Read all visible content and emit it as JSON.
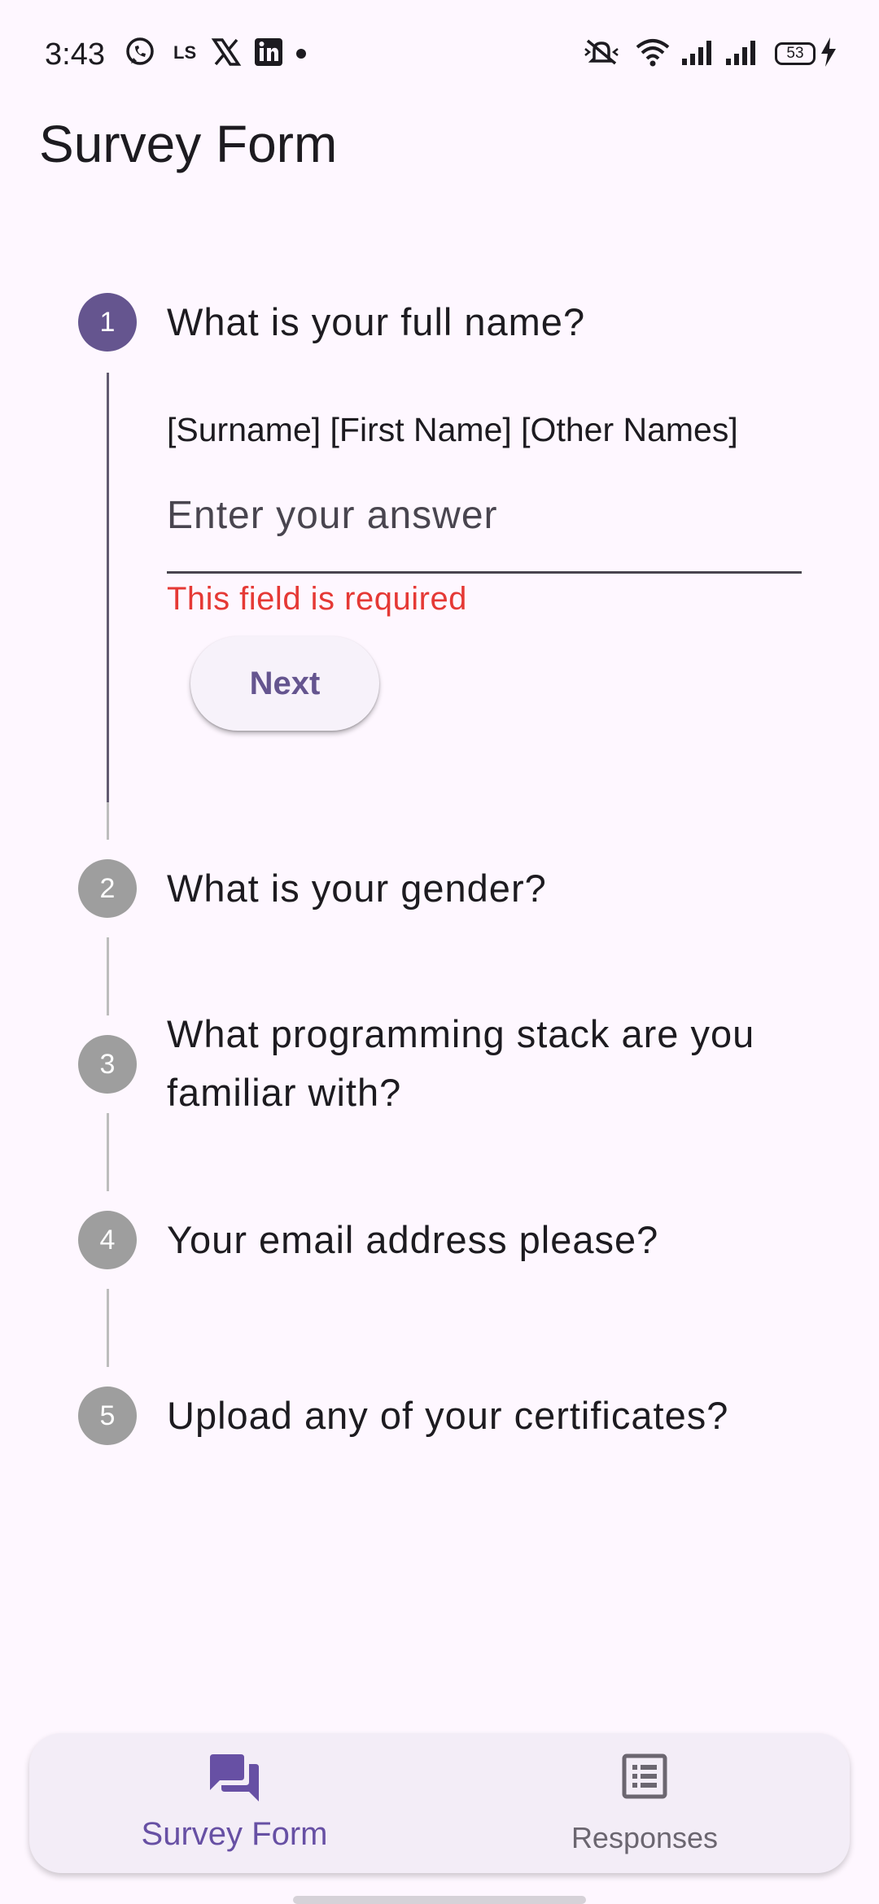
{
  "status_bar": {
    "time": "3:43",
    "battery": "53",
    "icons": [
      "whatsapp-icon",
      "ls-icon",
      "x-icon",
      "linkedin-icon",
      "notification-dot",
      "mute-icon",
      "wifi-icon",
      "signal-icon",
      "signal-icon",
      "battery-icon",
      "charging-icon"
    ]
  },
  "app": {
    "title": "Survey Form"
  },
  "steps": [
    {
      "number": "1",
      "title": "What is your full name?",
      "state": "active"
    },
    {
      "number": "2",
      "title": "What is your gender?",
      "state": "inactive"
    },
    {
      "number": "3",
      "title_line1": "What programming stack are you",
      "title_line2": "familiar with?",
      "state": "inactive"
    },
    {
      "number": "4",
      "title": "Your email address please?",
      "state": "inactive"
    },
    {
      "number": "5",
      "title": "Upload any of your certificates?",
      "state": "inactive"
    }
  ],
  "step1_content": {
    "helper": "[Surname] [First Name] [Other Names]",
    "input_value": "",
    "input_placeholder": "Enter your answer",
    "error": "This field is required",
    "next_label": "Next"
  },
  "bottom_nav": {
    "items": [
      {
        "label": "Survey Form",
        "icon": "forum-icon",
        "selected": true
      },
      {
        "label": "Responses",
        "icon": "list-alt-icon",
        "selected": false
      }
    ]
  },
  "colors": {
    "primary": "#65558F",
    "nav_selected": "#6750A4",
    "error": "#E53935",
    "background": "#FEF7FF"
  }
}
